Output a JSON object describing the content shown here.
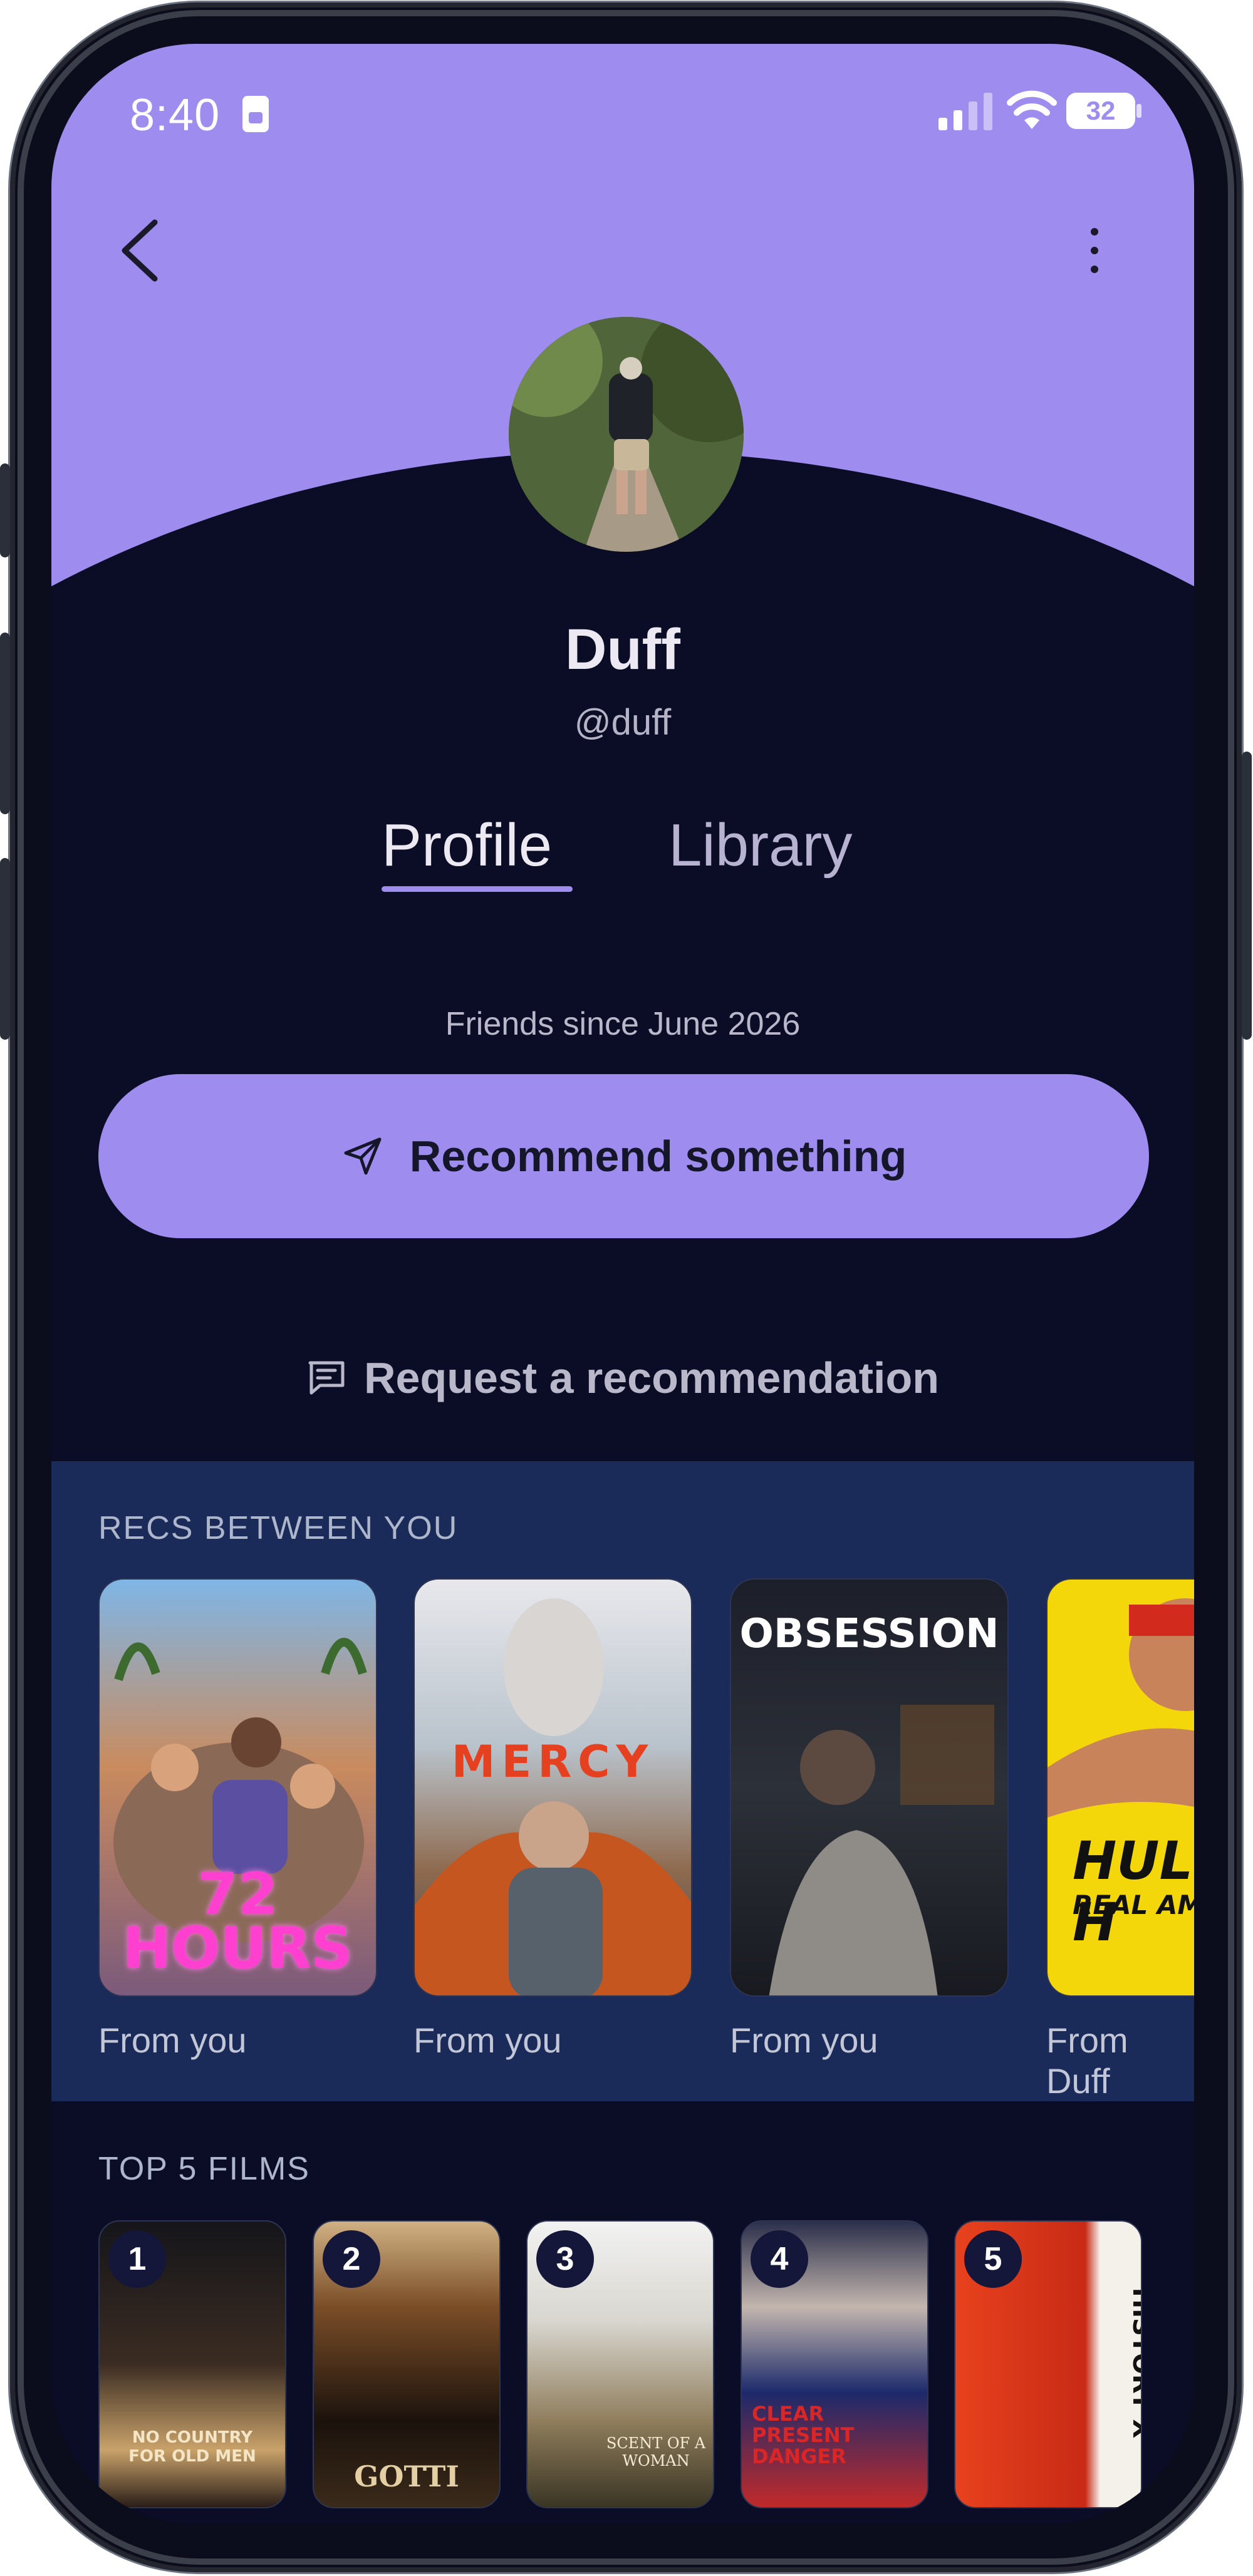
{
  "status_bar": {
    "time": "8:40",
    "battery": "32"
  },
  "profile": {
    "name": "Duff",
    "handle": "@duff",
    "friends_since": "Friends since June 2026"
  },
  "tabs": [
    {
      "label": "Profile",
      "active": true
    },
    {
      "label": "Library",
      "active": false
    }
  ],
  "actions": {
    "recommend_label": "Recommend something",
    "request_label": "Request a recommendation"
  },
  "recs": {
    "title": "RECS BETWEEN YOU",
    "items": [
      {
        "poster_text": "72 HOURS",
        "caption": "From you"
      },
      {
        "poster_text": "MERCY",
        "caption": "From you"
      },
      {
        "poster_text": "OBSESSION",
        "caption": "From you"
      },
      {
        "poster_text": "HULK H",
        "poster_subtext": "REAL AM",
        "caption": "From Duff"
      }
    ]
  },
  "top_films": {
    "title": "TOP 5 FILMS",
    "items": [
      {
        "rank": "1",
        "poster_text": "NO COUNTRY FOR OLD MEN"
      },
      {
        "rank": "2",
        "poster_text": "GOTTI"
      },
      {
        "rank": "3",
        "poster_text": "SCENT OF A WOMAN"
      },
      {
        "rank": "4",
        "poster_text": "CLEAR PRESENT DANGER"
      },
      {
        "rank": "5",
        "poster_text": "AMERICAN HISTORY X"
      }
    ]
  },
  "colors": {
    "accent": "#9e8cee",
    "background": "#0b0d27",
    "section": "#1a2a59"
  }
}
